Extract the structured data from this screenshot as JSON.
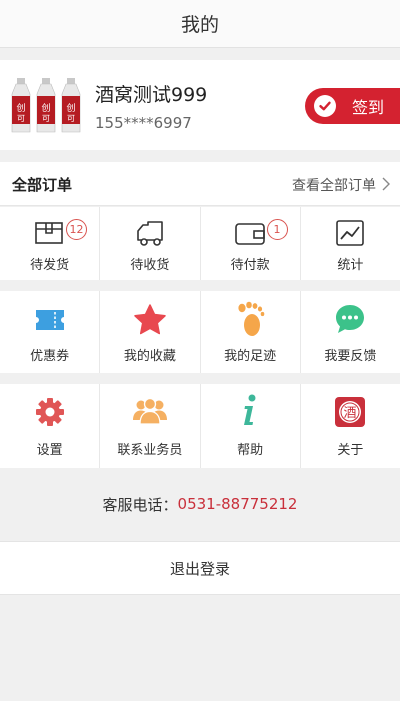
{
  "header": {
    "title": "我的"
  },
  "profile": {
    "name": "酒窝测试999",
    "phone": "155****6997",
    "checkin_label": "签到"
  },
  "orders": {
    "title": "全部订单",
    "view_all": "查看全部订单",
    "items": [
      {
        "label": "待发货",
        "icon": "package-box-icon",
        "badge": "12"
      },
      {
        "label": "待收货",
        "icon": "delivery-truck-icon"
      },
      {
        "label": "待付款",
        "icon": "wallet-icon",
        "badge": "1"
      },
      {
        "label": "统计",
        "icon": "line-chart-icon"
      }
    ]
  },
  "features": [
    {
      "label": "优惠券",
      "icon": "coupon-icon"
    },
    {
      "label": "我的收藏",
      "icon": "star-icon"
    },
    {
      "label": "我的足迹",
      "icon": "footprint-icon"
    },
    {
      "label": "我要反馈",
      "icon": "chat-bubble-icon"
    }
  ],
  "services": [
    {
      "label": "设置",
      "icon": "gear-icon"
    },
    {
      "label": "联系业务员",
      "icon": "people-group-icon"
    },
    {
      "label": "帮助",
      "icon": "info-icon"
    },
    {
      "label": "关于",
      "icon": "liquor-logo-icon"
    }
  ],
  "hotline": {
    "label": "客服电话：",
    "number": "0531-88775212"
  },
  "logout_label": "退出登录",
  "colors": {
    "accent": "#d42230",
    "coupon_blue": "#3d9fe0",
    "star_red": "#e8484f",
    "foot_orange": "#f5a64a",
    "chat_green": "#3cc28a",
    "gear_red": "#e05656",
    "people_orange": "#f5b062",
    "info_green": "#3db79a"
  }
}
